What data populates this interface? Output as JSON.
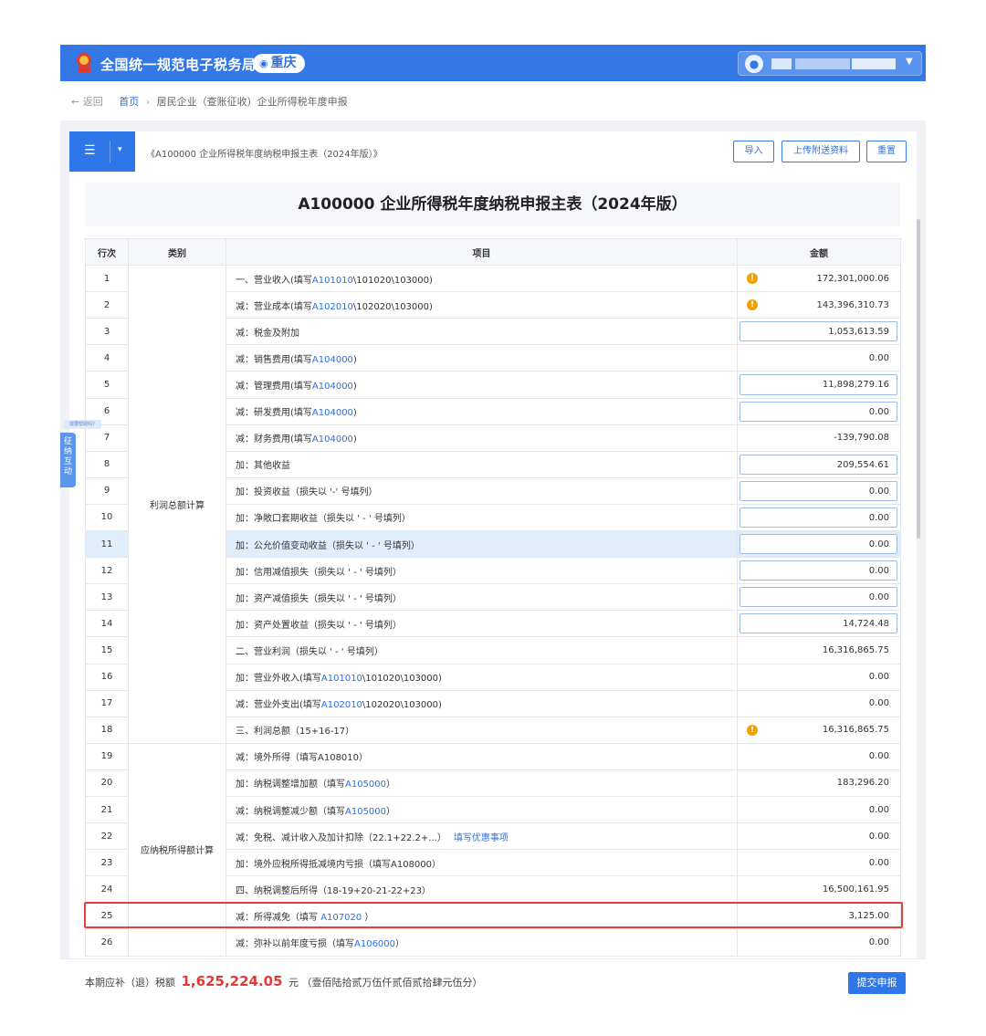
{
  "header": {
    "site_name": "全国统一规范电子税务局",
    "region": "重庆",
    "icons": {
      "emblem": "national-emblem-icon",
      "location": "location-pin-icon",
      "user": "user-avatar-icon",
      "dropdown": "caret-down-icon"
    }
  },
  "breadcrumb": {
    "back": "← 返回",
    "home": "首页",
    "separator": "›",
    "current": "居民企业（查账征收）企业所得税年度申报"
  },
  "toolbar": {
    "menu_icon": "☰",
    "dropdown_icon": "▾",
    "form_name": "《A100000 企业所得税年度纳税申报主表（2024年版）》",
    "import_label": "导入",
    "upload_label": "上传附送资料",
    "reset_label": "重置"
  },
  "table_title": "A100000 企业所得税年度纳税申报主表（2024年版）",
  "table": {
    "headers": [
      "行次",
      "类别",
      "项目",
      "金额"
    ],
    "categories": [
      "利润总额计算",
      "应纳税所得额计算"
    ],
    "rows": [
      {
        "no": "1",
        "pre": "一、营业收入(填写",
        "link": "A101010",
        "post": "\\101020\\103000)",
        "amount": "172,301,000.06",
        "mode": "warn"
      },
      {
        "no": "2",
        "pre": "减：营业成本(填写",
        "link": "A102010",
        "post": "\\102020\\103000)",
        "amount": "143,396,310.73",
        "mode": "warn"
      },
      {
        "no": "3",
        "pre": "减：税金及附加",
        "link": "",
        "post": "",
        "amount": "1,053,613.59",
        "mode": "input"
      },
      {
        "no": "4",
        "pre": "减：销售费用(填写",
        "link": "A104000",
        "post": ")",
        "amount": "0.00",
        "mode": "text"
      },
      {
        "no": "5",
        "pre": "减：管理费用(填写",
        "link": "A104000",
        "post": ")",
        "amount": "11,898,279.16",
        "mode": "input"
      },
      {
        "no": "6",
        "pre": "减：研发费用(填写",
        "link": "A104000",
        "post": ")",
        "amount": "0.00",
        "mode": "input"
      },
      {
        "no": "7",
        "pre": "减：财务费用(填写",
        "link": "A104000",
        "post": ")",
        "amount": "-139,790.08",
        "mode": "text"
      },
      {
        "no": "8",
        "pre": "加：其他收益",
        "link": "",
        "post": "",
        "amount": "209,554.61",
        "mode": "input"
      },
      {
        "no": "9",
        "pre": "加：投资收益（损失以 '-' 号填列）",
        "link": "",
        "post": "",
        "amount": "0.00",
        "mode": "input"
      },
      {
        "no": "10",
        "pre": "加：净敞口套期收益（损失以 ' - ' 号填列）",
        "link": "",
        "post": "",
        "amount": "0.00",
        "mode": "input"
      },
      {
        "no": "11",
        "pre": "加：公允价值变动收益（损失以 ' - ' 号填列）",
        "link": "",
        "post": "",
        "amount": "0.00",
        "mode": "input"
      },
      {
        "no": "12",
        "pre": "加：信用减值损失（损失以 ' - ' 号填列）",
        "link": "",
        "post": "",
        "amount": "0.00",
        "mode": "input"
      },
      {
        "no": "13",
        "pre": "加：资产减值损失（损失以 ' - ' 号填列）",
        "link": "",
        "post": "",
        "amount": "0.00",
        "mode": "input"
      },
      {
        "no": "14",
        "pre": "加：资产处置收益（损失以 ' - ' 号填列）",
        "link": "",
        "post": "",
        "amount": "14,724.48",
        "mode": "input"
      },
      {
        "no": "15",
        "pre": "二、营业利润（损失以 ' - ' 号填列）",
        "link": "",
        "post": "",
        "amount": "16,316,865.75",
        "mode": "text"
      },
      {
        "no": "16",
        "pre": "加：营业外收入(填写",
        "link": "A101010",
        "post": "\\101020\\103000)",
        "amount": "0.00",
        "mode": "text"
      },
      {
        "no": "17",
        "pre": "减：营业外支出(填写",
        "link": "A102010",
        "post": "\\102020\\103000)",
        "amount": "0.00",
        "mode": "text"
      },
      {
        "no": "18",
        "pre": "三、利润总额（15+16-17）",
        "link": "",
        "post": "",
        "amount": "16,316,865.75",
        "mode": "warn"
      },
      {
        "no": "19",
        "pre": "减：境外所得（填写A108010）",
        "link": "",
        "post": "",
        "amount": "0.00",
        "mode": "text"
      },
      {
        "no": "20",
        "pre": "加：纳税调整增加额（填写",
        "link": "A105000",
        "post": "）",
        "amount": "183,296.20",
        "mode": "text"
      },
      {
        "no": "21",
        "pre": "减：纳税调整减少额（填写",
        "link": "A105000",
        "post": "）",
        "amount": "0.00",
        "mode": "text"
      },
      {
        "no": "22",
        "pre": "减：免税、减计收入及加计扣除（22.1+22.2+...）",
        "link": "填写优惠事项",
        "post": "",
        "amount": "0.00",
        "mode": "text"
      },
      {
        "no": "23",
        "pre": "加：境外应税所得抵减境内亏损（填写A108000）",
        "link": "",
        "post": "",
        "amount": "0.00",
        "mode": "text"
      },
      {
        "no": "24",
        "pre": "四、纳税调整后所得（18-19+20-21-22+23）",
        "link": "",
        "post": "",
        "amount": "16,500,161.95",
        "mode": "text"
      },
      {
        "no": "25",
        "pre": "减：所得减免（填写 ",
        "link": "A107020",
        "post": " ）",
        "amount": "3,125.00",
        "mode": "text"
      },
      {
        "no": "26",
        "pre": "减：弥补以前年度亏损（填写",
        "link": "A106000",
        "post": "）",
        "amount": "0.00",
        "mode": "text"
      }
    ]
  },
  "side": {
    "tag": "需要帮助吗?",
    "tab": "征纳互动"
  },
  "footer": {
    "prefix": "本期应补（退）税额",
    "amount": "1,625,224.05",
    "unit": "元",
    "uppercase": "（壹佰陆拾贰万伍仟贰佰贰拾肆元伍分）",
    "submit_label": "提交申报"
  },
  "colors": {
    "primary": "#3478e6",
    "warning": "#f0a000",
    "money": "#e53935",
    "highlight_border": "#e5403a"
  }
}
